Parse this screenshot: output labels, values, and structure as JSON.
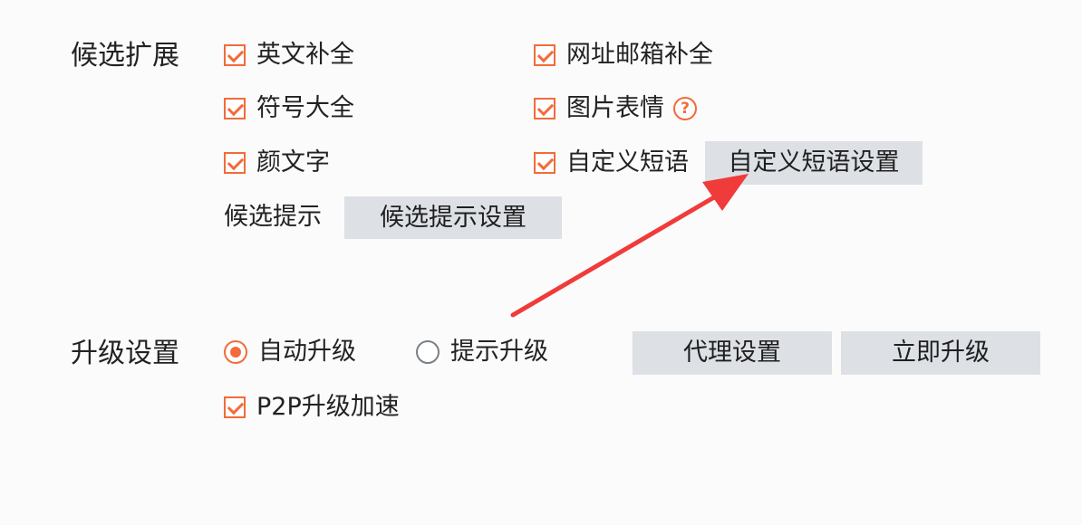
{
  "candidate_extension": {
    "title": "候选扩展",
    "options": [
      {
        "label": "英文补全",
        "checked": true
      },
      {
        "label": "网址邮箱补全",
        "checked": true
      },
      {
        "label": "符号大全",
        "checked": true
      },
      {
        "label": "图片表情",
        "checked": true,
        "help_icon": "question-circle-icon"
      },
      {
        "label": "颜文字",
        "checked": true
      },
      {
        "label": "自定义短语",
        "checked": true
      }
    ],
    "custom_phrase_settings_label": "自定义短语设置",
    "candidate_hint_label": "候选提示",
    "candidate_hint_settings_label": "候选提示设置"
  },
  "upgrade_settings": {
    "title": "升级设置",
    "mode_options": [
      {
        "label": "自动升级",
        "selected": true
      },
      {
        "label": "提示升级",
        "selected": false
      }
    ],
    "proxy_settings_label": "代理设置",
    "upgrade_now_label": "立即升级",
    "p2p_accel": {
      "label": "P2P升级加速",
      "checked": true
    }
  },
  "colors": {
    "accent": "#f26b3a",
    "button_bg": "#dde0e5",
    "annotation_arrow": "#f03b3b",
    "background": "#fbfbfb"
  }
}
